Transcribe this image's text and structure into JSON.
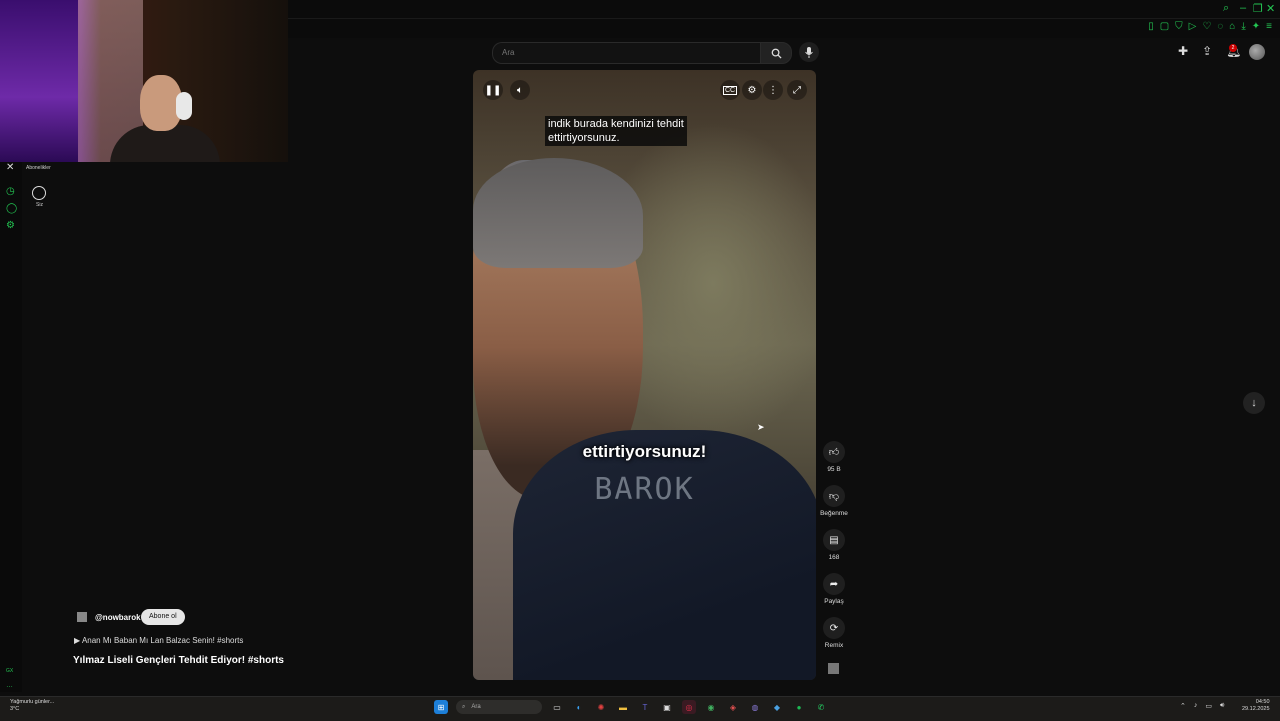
{
  "search": {
    "placeholder": "Ara"
  },
  "sidebar": {
    "subscriptions_label": "Abonelikler",
    "you_label": "Siz",
    "rail_bottom": "GX"
  },
  "header": {
    "notification_count": "2"
  },
  "video": {
    "caption": "indik burada kendinizi tehdit\nettirtiyorsunuz.",
    "burned_subtitle": "ettirtiyorsunuz!",
    "watermark": "BAROK",
    "state": "playing"
  },
  "actions": {
    "like_count": "95 B",
    "dislike_label": "Beğenme",
    "comment_count": "168",
    "share_label": "Paylaş",
    "remix_label": "Remix"
  },
  "short_info": {
    "channel": "@nowbarok",
    "subscribe_label": "Abone ol",
    "music": "Anan Mı Baban Mı Lan Balzac Senin! #shorts",
    "title": "Yılmaz Liseli Gençleri Tehdit Ediyor! #shorts"
  },
  "taskbar": {
    "weather_line1": "Yağmurlu günler...",
    "weather_line2": "3°C",
    "search_label": "Ara",
    "time": "04:50",
    "date": "29.12.2025"
  },
  "colors": {
    "accent": "#23c552",
    "subscribe_bg": "#e6e6e6",
    "background": "#0d0d0d"
  }
}
